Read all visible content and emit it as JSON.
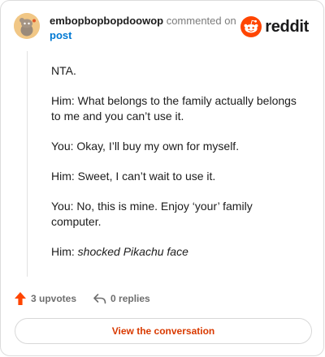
{
  "comment": {
    "username": "embopbopbopdoowop",
    "action_text": "commented on",
    "target_link": "post",
    "avatar_icon": "snoo-avatar-icon",
    "paragraphs": [
      "NTA.",
      "Him: What belongs to the family actually belongs to me and you can’t use it.",
      "You: Okay, I’ll buy my own for myself.",
      "Him: Sweet, I can’t wait to use it.",
      "You: No, this is mine. Enjoy ‘your’ family computer."
    ],
    "last_line_prefix": "Him: ",
    "last_line_italic": "shocked Pikachu face"
  },
  "brand": {
    "name": "reddit",
    "logo_icon": "reddit-logo-icon",
    "color": "#ff4500"
  },
  "footer": {
    "upvotes_label": "3 upvotes",
    "replies_label": "0 replies",
    "upvote_icon": "upvote-arrow-icon",
    "reply_icon": "reply-arrow-icon",
    "upvote_color": "#ff4500"
  },
  "cta": {
    "label": "View the conversation",
    "color": "#d93a00"
  }
}
